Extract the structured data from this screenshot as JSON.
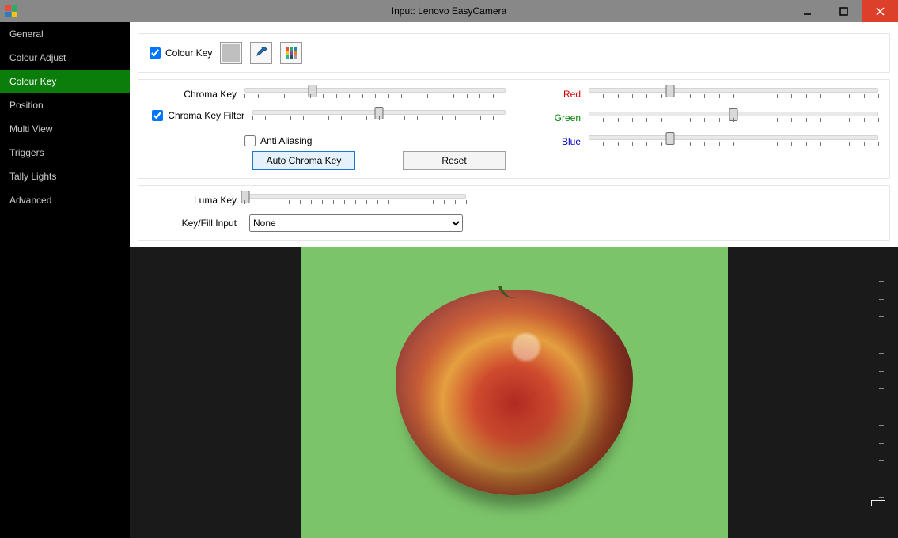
{
  "window": {
    "title": "Input: Lenovo EasyCamera"
  },
  "sidebar": {
    "items": [
      {
        "label": "General"
      },
      {
        "label": "Colour Adjust"
      },
      {
        "label": "Colour Key",
        "active": true
      },
      {
        "label": "Position"
      },
      {
        "label": "Multi View"
      },
      {
        "label": "Triggers"
      },
      {
        "label": "Tally Lights"
      },
      {
        "label": "Advanced"
      }
    ]
  },
  "top": {
    "colour_key_checkbox": "Colour Key",
    "colour_key_checked": true,
    "swatch_color": "#bfbfbf"
  },
  "sliders": {
    "chroma_key": {
      "label": "Chroma Key",
      "value": 26,
      "checkbox": null
    },
    "chroma_key_filter": {
      "label": "Chroma Key Filter",
      "value": 50,
      "checkbox": true
    },
    "anti_aliasing": {
      "label": "Anti Aliasing",
      "checkbox": false
    },
    "red": {
      "label": "Red",
      "value": 28
    },
    "green": {
      "label": "Green",
      "value": 50
    },
    "blue": {
      "label": "Blue",
      "value": 28
    },
    "luma_key": {
      "label": "Luma Key",
      "value": 0
    }
  },
  "buttons": {
    "auto_chroma": "Auto Chroma Key",
    "reset": "Reset"
  },
  "key_fill": {
    "label": "Key/Fill Input",
    "selected": "None",
    "options": [
      "None"
    ]
  },
  "vlevel": {
    "value": 0
  }
}
